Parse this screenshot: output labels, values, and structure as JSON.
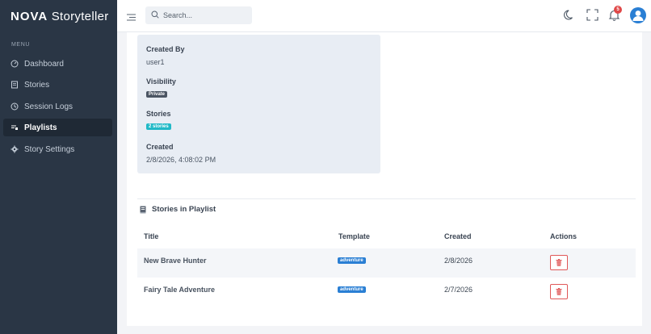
{
  "app": {
    "brand_bold": "NOVA",
    "brand_rest": "Storyteller"
  },
  "sidebar": {
    "menu_label": "MENU",
    "items": [
      {
        "label": "Dashboard",
        "icon": "dashboard-icon"
      },
      {
        "label": "Stories",
        "icon": "stories-icon"
      },
      {
        "label": "Session Logs",
        "icon": "history-icon"
      },
      {
        "label": "Playlists",
        "icon": "playlist-icon",
        "active": true
      },
      {
        "label": "Story Settings",
        "icon": "gear-icon"
      }
    ]
  },
  "topbar": {
    "search_placeholder": "Search...",
    "notification_count": "5"
  },
  "details": {
    "created_by_label": "Created By",
    "created_by_value": "user1",
    "visibility_label": "Visibility",
    "visibility_value": "Private",
    "stories_label": "Stories",
    "stories_value": "2 stories",
    "created_label": "Created",
    "created_value": "2/8/2026, 4:08:02 PM"
  },
  "stories_section": {
    "title": "Stories in Playlist",
    "columns": [
      "Title",
      "Template",
      "Created",
      "Actions"
    ],
    "rows": [
      {
        "title": "New Brave Hunter",
        "template": "adventure",
        "created": "2/8/2026"
      },
      {
        "title": "Fairy Tale Adventure",
        "template": "adventure",
        "created": "2/7/2026"
      }
    ]
  },
  "colors": {
    "sidebar_bg": "#2a3645",
    "accent": "#2a7fd4",
    "stories_badge": "#21b9c7",
    "danger": "#e05858"
  }
}
